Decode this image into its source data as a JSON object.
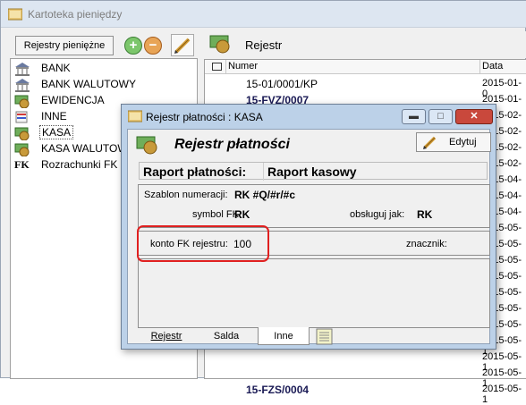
{
  "main_window": {
    "title": "Kartoteka pieniędzy"
  },
  "left": {
    "registers_button": "Rejestry pieniężne",
    "plus_symbol": "+",
    "minus_symbol": "−",
    "tree": [
      {
        "label": "BANK",
        "icon": "bank-icon"
      },
      {
        "label": "BANK WALUTOWY",
        "icon": "bank-icon"
      },
      {
        "label": "EWIDENCJA",
        "icon": "money-icon"
      },
      {
        "label": "INNE",
        "icon": "document-icon"
      },
      {
        "label": "KASA",
        "icon": "money-icon"
      },
      {
        "label": "KASA WALUTOWY",
        "icon": "money-icon"
      },
      {
        "label": "Rozrachunki FK",
        "icon": "fk-icon"
      }
    ],
    "fk_icon_text": "FK"
  },
  "right": {
    "heading": "Rejestr",
    "columns": {
      "number": "Numer",
      "date": "Data"
    },
    "rows": [
      {
        "number": "15-01/0001/KP",
        "date": "2015-01-0",
        "bold": false
      },
      {
        "number": "15-FVZ/0007",
        "date": "2015-01-3",
        "bold": true
      },
      {
        "number": "",
        "date": "2015-02-0",
        "bold": false
      },
      {
        "number": "",
        "date": "2015-02-0",
        "bold": false
      },
      {
        "number": "",
        "date": "2015-02-0",
        "bold": false
      },
      {
        "number": "",
        "date": "2015-02-0",
        "bold": false
      },
      {
        "number": "",
        "date": "2015-04-0",
        "bold": false
      },
      {
        "number": "",
        "date": "2015-04-0",
        "bold": false
      },
      {
        "number": "",
        "date": "2015-04-0",
        "bold": false
      },
      {
        "number": "",
        "date": "2015-05-0",
        "bold": false
      },
      {
        "number": "",
        "date": "2015-05-0",
        "bold": false
      },
      {
        "number": "",
        "date": "2015-05-0",
        "bold": false
      },
      {
        "number": "",
        "date": "2015-05-0",
        "bold": false
      },
      {
        "number": "",
        "date": "2015-05-0",
        "bold": false
      },
      {
        "number": "",
        "date": "2015-05-0",
        "bold": false
      },
      {
        "number": "",
        "date": "2015-05-1",
        "bold": false
      },
      {
        "number": "",
        "date": "2015-05-1",
        "bold": false
      },
      {
        "number": "",
        "date": "2015-05-1",
        "bold": false
      },
      {
        "number": "",
        "date": "2015-05-1",
        "bold": false
      },
      {
        "number": "15-FZS/0004",
        "date": "2015-05-1",
        "bold": true
      }
    ]
  },
  "dialog": {
    "title": "Rejestr płatności : KASA",
    "heading": "Rejestr płatności",
    "edit_button": "Edytuj",
    "raport_label": "Raport płatności:",
    "raport_value": "Raport kasowy",
    "numbering_label": "Szablon numeracji:",
    "numbering_value": "RK #Q/#r/#c",
    "symbol_fk_label": "symbol FK:",
    "symbol_fk_value": "RK",
    "handle_as_label": "obsługuj jak:",
    "handle_as_value": "RK",
    "fk_account_label": "konto FK rejestru:",
    "fk_account_value": "100",
    "marker_label": "znacznik:",
    "tabs": [
      "Rejestr",
      "Salda",
      "Inne"
    ],
    "active_tab": "Inne",
    "minimize_symbol": "▬",
    "maximize_symbol": "□",
    "close_symbol": "✕"
  },
  "colors": {
    "highlight": "#e02020",
    "bold_row_text": "#1a1a55"
  }
}
